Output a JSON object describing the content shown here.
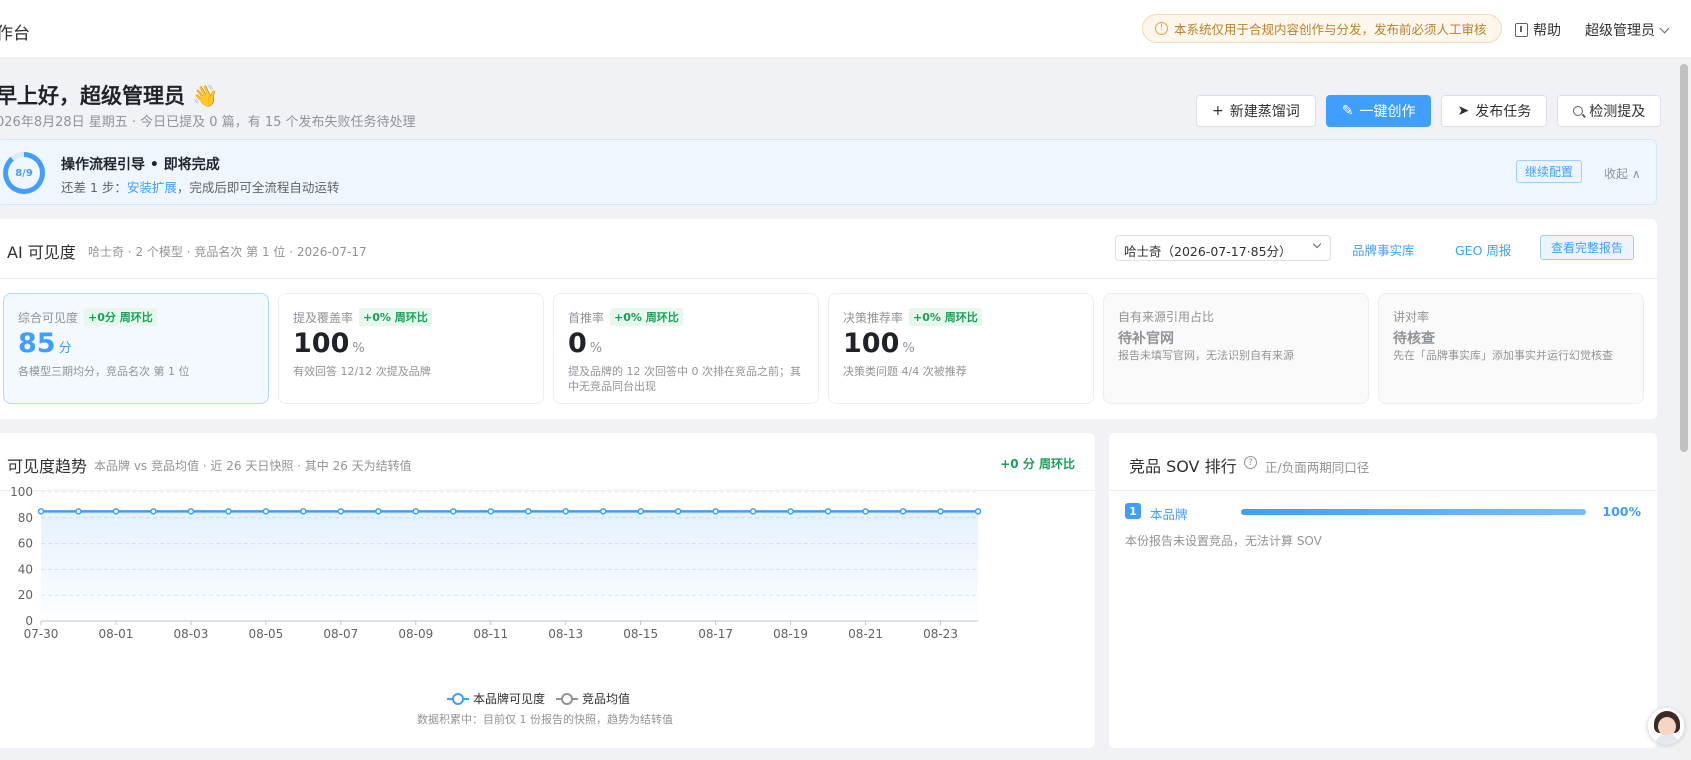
{
  "topbar": {
    "title": "作台",
    "notice": "本系统仅用于合规内容创作与分发，发布前必须人工审核",
    "help": "帮助",
    "user": "超级管理员"
  },
  "greeting": {
    "title": "早上好，超级管理员 👋",
    "subtitle": "026年8月28日 星期五 · 今日已提及 0 篇，有 15 个发布失败任务待处理"
  },
  "actions": {
    "new_keyword": "新建蒸馏词",
    "one_click": "一键创作",
    "publish": "发布任务",
    "detect": "检测提及"
  },
  "guide": {
    "progress_label": "8/9",
    "progress": 0.89,
    "title": "操作流程引导 • 即将完成",
    "sub_prefix": "还差 1 步：",
    "sub_link": "安装扩展",
    "sub_suffix": "，完成后即可全流程自动运转",
    "continue": "继续配置",
    "collapse": "收起 ∧"
  },
  "visibility": {
    "title": "AI 可见度",
    "meta": "哈士奇 · 2 个模型 · 竞品名次 第 1 位 · 2026-07-17",
    "select_value": "哈士奇（2026-07-17·85分）",
    "link_facts": "品牌事实库",
    "link_weekly": "GEO 周报",
    "full_report": "查看完整报告",
    "metrics": [
      {
        "label": "综合可见度",
        "badge": "+0分 周环比",
        "value": "85",
        "unit": "分",
        "desc": "各模型三期均分，竞品名次 第 1 位"
      },
      {
        "label": "提及覆盖率",
        "badge": "+0% 周环比",
        "value": "100",
        "unit": "%",
        "desc": "有效回答 12/12 次提及品牌"
      },
      {
        "label": "首推率",
        "badge": "+0% 周环比",
        "value": "0",
        "unit": "%",
        "desc": "提及品牌的 12 次回答中 0 次排在竞品之前；其中无竞品同台出现"
      },
      {
        "label": "决策推荐率",
        "badge": "+0% 周环比",
        "value": "100",
        "unit": "%",
        "desc": "决策类问题 4/4 次被推荐"
      },
      {
        "label": "自有来源引用占比",
        "value_text": "待补官网",
        "desc": "报告未填写官网，无法识别自有来源"
      },
      {
        "label": "讲对率",
        "value_text": "待核查",
        "desc": "先在「品牌事实库」添加事实并运行幻觉核查"
      }
    ]
  },
  "trend": {
    "title": "可见度趋势",
    "meta": "本品牌 vs 竞品均值 · 近 26 天日快照 · 其中 26 天为结转值",
    "delta": "+0 分 周环比",
    "footnote": "数据积累中：目前仅 1 份报告的快照，趋势为结转值"
  },
  "chart_data": {
    "type": "line",
    "title": "",
    "xlabel": "",
    "ylabel": "",
    "ylim": [
      0,
      100
    ],
    "yticks": [
      0,
      20,
      40,
      60,
      80,
      100
    ],
    "x": [
      "07-30",
      "07-31",
      "08-01",
      "08-02",
      "08-03",
      "08-04",
      "08-05",
      "08-06",
      "08-07",
      "08-08",
      "08-09",
      "08-10",
      "08-11",
      "08-12",
      "08-13",
      "08-14",
      "08-15",
      "08-16",
      "08-17",
      "08-18",
      "08-19",
      "08-20",
      "08-21",
      "08-22",
      "08-23",
      "08-24"
    ],
    "xtick_labels": [
      "07-30",
      "08-01",
      "08-03",
      "08-05",
      "08-07",
      "08-09",
      "08-11",
      "08-13",
      "08-15",
      "08-17",
      "08-19",
      "08-21",
      "08-23"
    ],
    "series": [
      {
        "name": "本品牌可见度",
        "values": [
          85,
          85,
          85,
          85,
          85,
          85,
          85,
          85,
          85,
          85,
          85,
          85,
          85,
          85,
          85,
          85,
          85,
          85,
          85,
          85,
          85,
          85,
          85,
          85,
          85,
          85
        ],
        "color": "#409eff"
      },
      {
        "name": "竞品均值",
        "values": [],
        "color": "#909399"
      }
    ],
    "grid": true,
    "legend": "bottom-center"
  },
  "sov": {
    "title": "竞品 SOV 排行",
    "meta": "正/负面两期同口径",
    "items": [
      {
        "rank": "1",
        "name": "本品牌",
        "share": 1.0,
        "pct": "100%"
      }
    ],
    "note": "本份报告未设置竞品，无法计算 SOV"
  },
  "colors": {
    "accent": "#409eff",
    "success": "#18a058",
    "warning": "#e6a23c"
  }
}
